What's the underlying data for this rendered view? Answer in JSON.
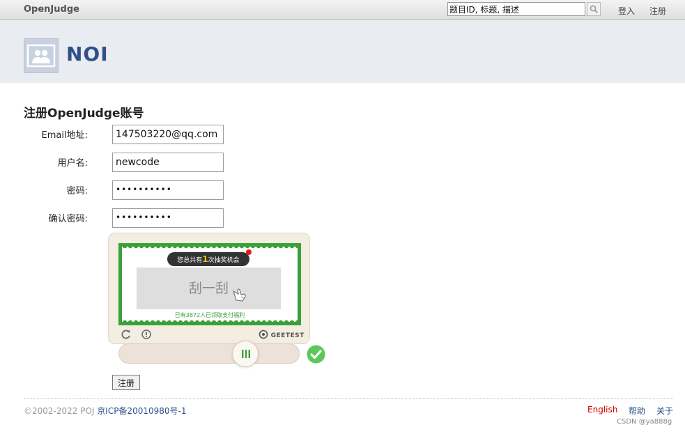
{
  "topbar": {
    "brand": "OpenJudge",
    "search_value": "题目ID, 标题, 描述",
    "login": "登入",
    "register": "注册"
  },
  "header": {
    "title": "NOI"
  },
  "form": {
    "title": "注册OpenJudge账号",
    "email_label": "Email地址:",
    "email_value": "147503220@qq.com",
    "username_label": "用户名:",
    "username_value": "newcode",
    "password_label": "密码:",
    "password_mask": "••••••••••",
    "confirm_label": "确认密码:",
    "confirm_mask": "••••••••••",
    "submit_label": "注册"
  },
  "captcha": {
    "pill_prefix": "您总共有",
    "pill_count": "1",
    "pill_suffix": "次抽奖机会",
    "scratch_text": "刮一刮",
    "note": "已有3872人已领取支付福利",
    "brand": "GEETEST",
    "status": "success"
  },
  "footer": {
    "copyright": "©2002-2022 POJ",
    "icp": "京ICP备20010980号-1",
    "english": "English",
    "help": "帮助",
    "about": "关于"
  },
  "watermark": "CSDN @ya888g",
  "colors": {
    "brand_blue": "#2f4f8a",
    "captcha_green": "#3aa13a",
    "english_red": "#cc0000",
    "success_green": "#5cc85c"
  }
}
